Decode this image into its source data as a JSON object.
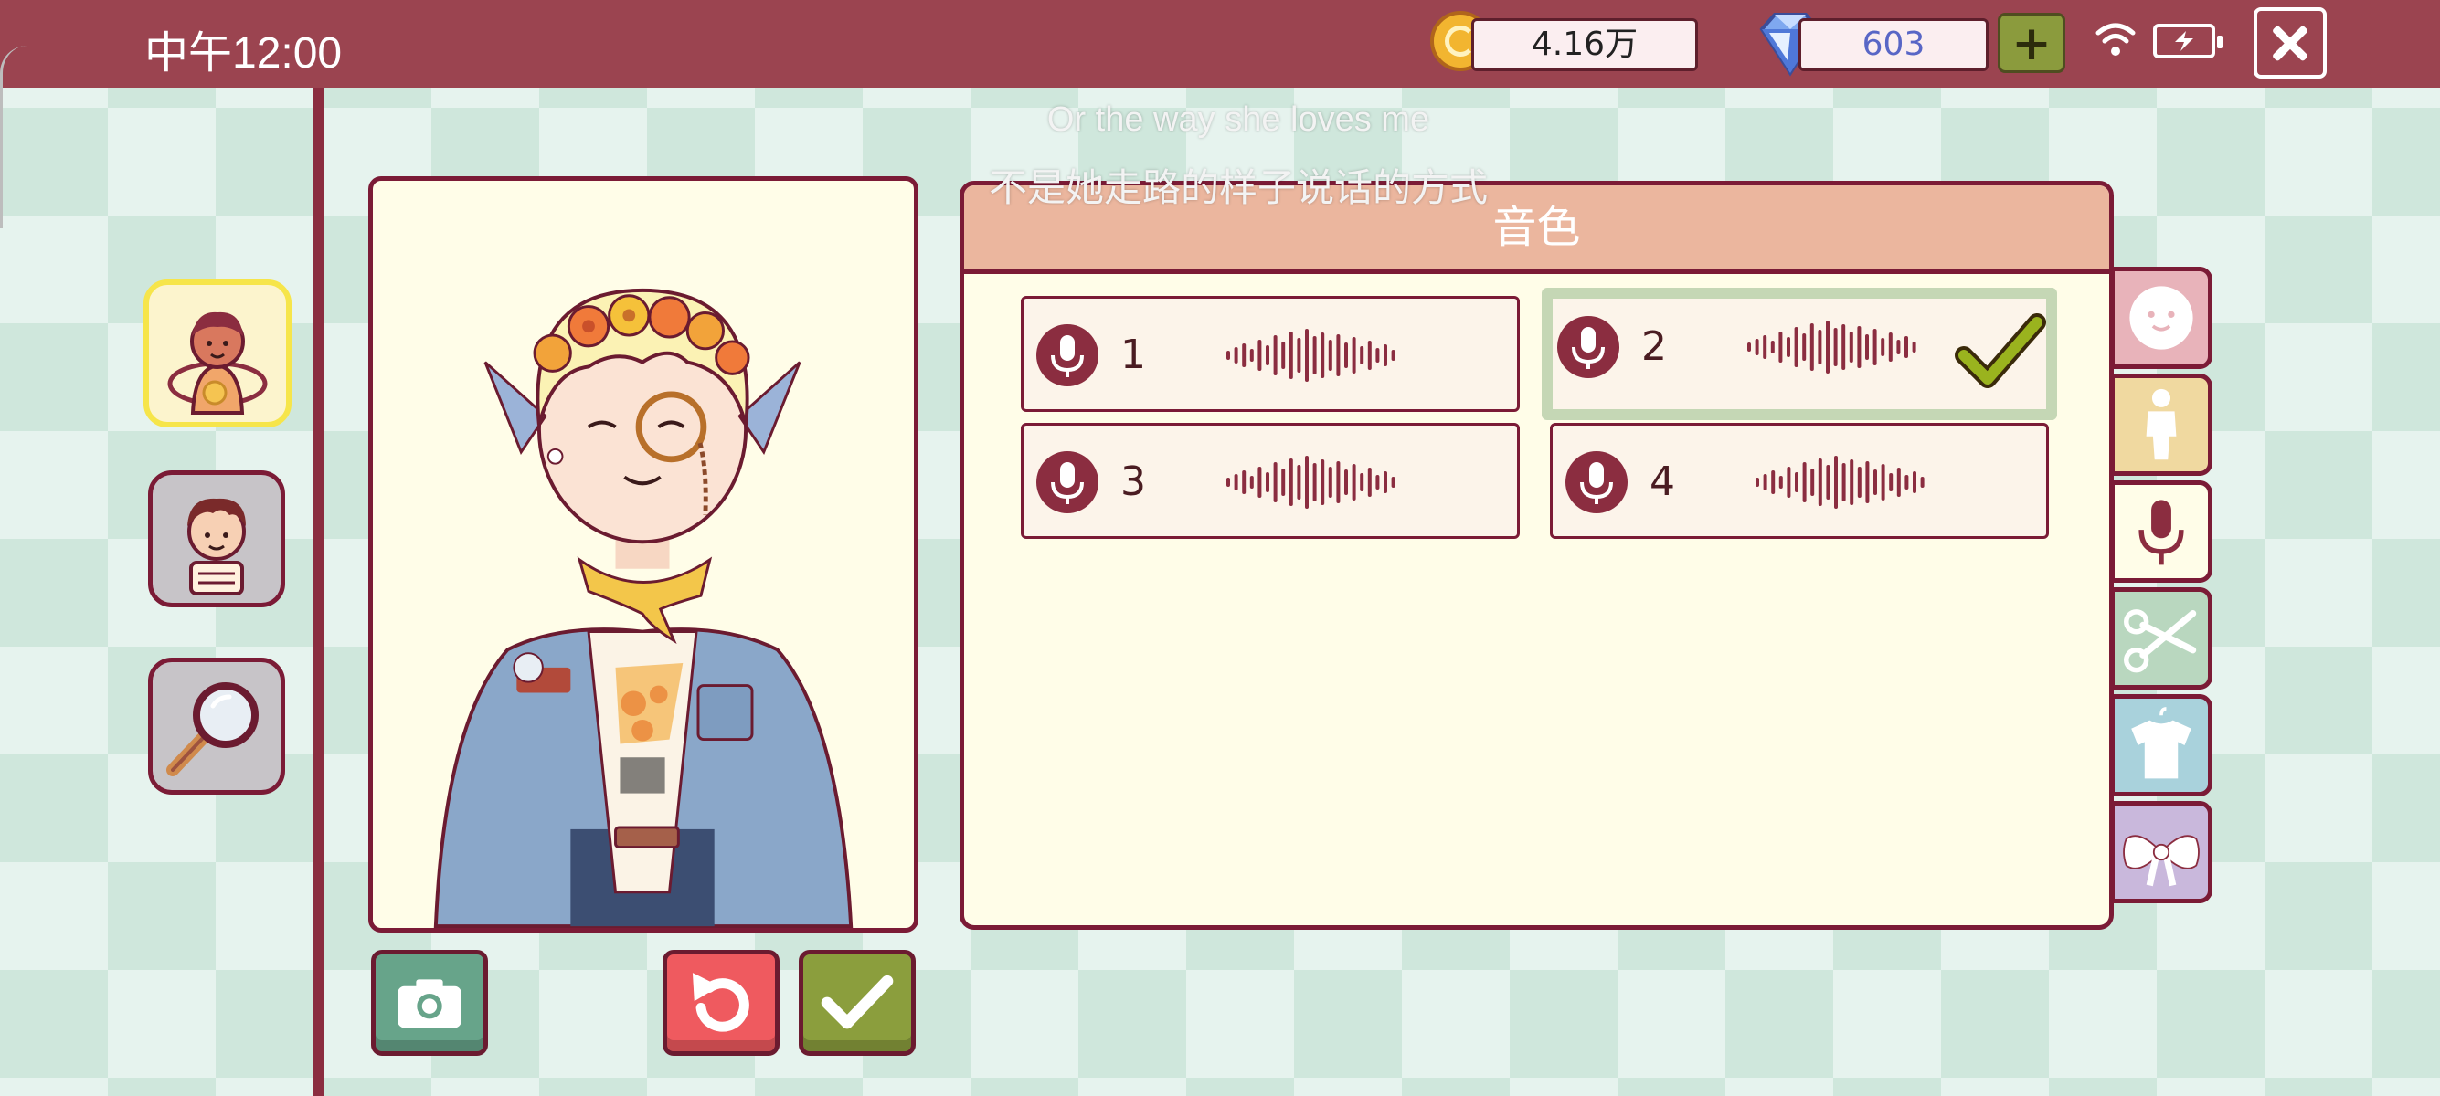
{
  "status_bar": {
    "time": "中午12:00",
    "coins": "4.16万",
    "gems": "603"
  },
  "subtitles": {
    "line1": "Or the way she loves me",
    "line2": "不是她走路的样子说话的方式"
  },
  "voice_panel": {
    "title": "音色",
    "options": [
      {
        "label": "1",
        "selected": false
      },
      {
        "label": "2",
        "selected": true
      },
      {
        "label": "3",
        "selected": false
      },
      {
        "label": "4",
        "selected": false
      }
    ]
  },
  "left_tabs": [
    "character-customize",
    "character-profile",
    "search"
  ],
  "right_tabs": [
    "face",
    "body",
    "voice",
    "hair",
    "clothes",
    "accessory"
  ],
  "bottom_buttons": [
    "camera",
    "reset",
    "confirm"
  ],
  "colors": {
    "top_bar": "#9b4450",
    "border": "#7b1b36",
    "panel_header": "#ebb69e",
    "panel_bg": "#fffde8",
    "selected_outline": "#c5d7b5",
    "checkmark": "#9ab31e"
  }
}
